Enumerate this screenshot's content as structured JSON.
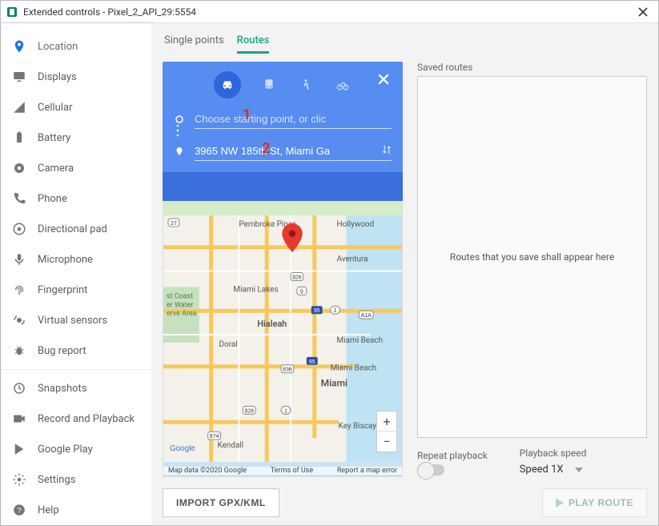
{
  "window": {
    "title": "Extended controls - Pixel_2_API_29:5554"
  },
  "sidebar": {
    "items": [
      {
        "label": "Location",
        "icon": "location-icon",
        "active": true
      },
      {
        "label": "Displays",
        "icon": "displays-icon"
      },
      {
        "label": "Cellular",
        "icon": "cellular-icon"
      },
      {
        "label": "Battery",
        "icon": "battery-icon"
      },
      {
        "label": "Camera",
        "icon": "camera-icon"
      },
      {
        "label": "Phone",
        "icon": "phone-icon"
      },
      {
        "label": "Directional pad",
        "icon": "dpad-icon"
      },
      {
        "label": "Microphone",
        "icon": "mic-icon"
      },
      {
        "label": "Fingerprint",
        "icon": "fingerprint-icon"
      },
      {
        "label": "Virtual sensors",
        "icon": "sensors-icon"
      },
      {
        "label": "Bug report",
        "icon": "bug-icon"
      },
      {
        "label": "Snapshots",
        "icon": "snapshots-icon"
      },
      {
        "label": "Record and Playback",
        "icon": "record-icon"
      },
      {
        "label": "Google Play",
        "icon": "play-icon"
      },
      {
        "label": "Settings",
        "icon": "settings-icon"
      },
      {
        "label": "Help",
        "icon": "help-icon"
      }
    ]
  },
  "tabs": {
    "items": [
      {
        "label": "Single points",
        "active": false
      },
      {
        "label": "Routes",
        "active": true
      }
    ]
  },
  "route_panel": {
    "start": {
      "value": "",
      "placeholder": "Choose starting point, or clic"
    },
    "dest": {
      "value": "3965 NW 185th St, Miami Ga"
    },
    "annotation1": "1",
    "annotation2": "2"
  },
  "map": {
    "labels": [
      "Pembroke Pines",
      "Hollywood",
      "Aventura",
      "Miami Lakes",
      "Hialeah",
      "Doral",
      "Miami Beach",
      "Miami Beach",
      "Miami",
      "Key Biscayne",
      "Kendall"
    ],
    "shields": [
      "27",
      "826",
      "9",
      "95",
      "1",
      "A1A",
      "836",
      "95",
      "826",
      "1",
      "874"
    ],
    "reserve_label_lines": [
      "st Coast",
      "er Water",
      "erve Area"
    ],
    "attribution": "Map data ©2020 Google",
    "terms": "Terms of Use",
    "report": "Report a map error",
    "logo_text": "Google"
  },
  "saved": {
    "label": "Saved routes",
    "empty_text": "Routes that you save shall appear here"
  },
  "controls": {
    "repeat_label": "Repeat playback",
    "speed_label": "Playback speed",
    "speed_value": "Speed 1X"
  },
  "buttons": {
    "import": "IMPORT GPX/KML",
    "play": "PLAY ROUTE"
  }
}
